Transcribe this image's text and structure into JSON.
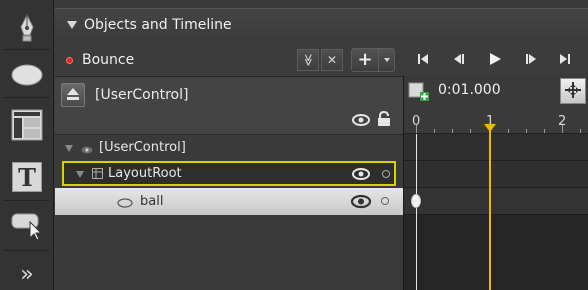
{
  "toolbar": {
    "tools": [
      {
        "icon": "pen-icon"
      },
      {
        "icon": "ellipse-icon"
      },
      {
        "icon": "grid-icon"
      },
      {
        "icon": "text-icon"
      },
      {
        "icon": "asset-icon"
      },
      {
        "icon": "expand-icon"
      }
    ],
    "text_tool_glyph": "T",
    "expand_glyph": "»"
  },
  "panel": {
    "title": "Objects and Timeline"
  },
  "storyboard": {
    "name": "Bounce",
    "buttons": {
      "options_glyph": "≫",
      "close_glyph": "✕",
      "add_glyph": "+"
    }
  },
  "tree": {
    "scope_label": "[UserControl]",
    "items": [
      {
        "label": "[UserControl]"
      },
      {
        "label": "LayoutRoot"
      },
      {
        "label": "ball"
      }
    ]
  },
  "timeline": {
    "current_time": "0:01.000",
    "ruler_labels": [
      "0",
      "1",
      "2"
    ]
  },
  "colors": {
    "record_dot": "#e0262b",
    "selection_outline": "#d8d200",
    "playhead": "#f0b800"
  }
}
